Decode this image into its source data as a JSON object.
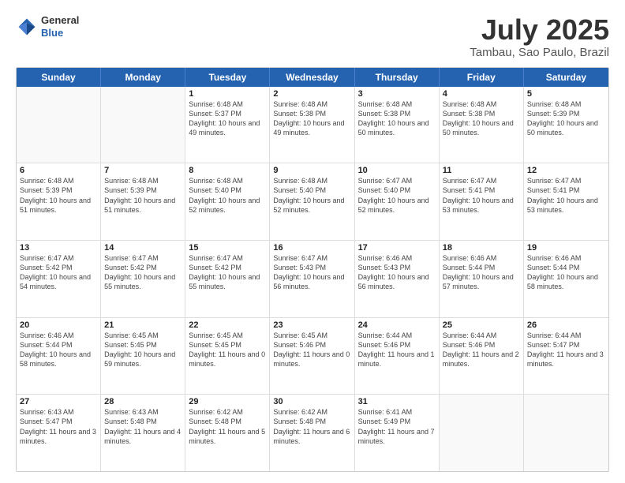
{
  "header": {
    "logo_line1": "General",
    "logo_line2": "Blue",
    "month_year": "July 2025",
    "location": "Tambau, Sao Paulo, Brazil"
  },
  "days_of_week": [
    "Sunday",
    "Monday",
    "Tuesday",
    "Wednesday",
    "Thursday",
    "Friday",
    "Saturday"
  ],
  "weeks": [
    [
      {
        "day": "",
        "info": ""
      },
      {
        "day": "",
        "info": ""
      },
      {
        "day": "1",
        "info": "Sunrise: 6:48 AM\nSunset: 5:37 PM\nDaylight: 10 hours and 49 minutes."
      },
      {
        "day": "2",
        "info": "Sunrise: 6:48 AM\nSunset: 5:38 PM\nDaylight: 10 hours and 49 minutes."
      },
      {
        "day": "3",
        "info": "Sunrise: 6:48 AM\nSunset: 5:38 PM\nDaylight: 10 hours and 50 minutes."
      },
      {
        "day": "4",
        "info": "Sunrise: 6:48 AM\nSunset: 5:38 PM\nDaylight: 10 hours and 50 minutes."
      },
      {
        "day": "5",
        "info": "Sunrise: 6:48 AM\nSunset: 5:39 PM\nDaylight: 10 hours and 50 minutes."
      }
    ],
    [
      {
        "day": "6",
        "info": "Sunrise: 6:48 AM\nSunset: 5:39 PM\nDaylight: 10 hours and 51 minutes."
      },
      {
        "day": "7",
        "info": "Sunrise: 6:48 AM\nSunset: 5:39 PM\nDaylight: 10 hours and 51 minutes."
      },
      {
        "day": "8",
        "info": "Sunrise: 6:48 AM\nSunset: 5:40 PM\nDaylight: 10 hours and 52 minutes."
      },
      {
        "day": "9",
        "info": "Sunrise: 6:48 AM\nSunset: 5:40 PM\nDaylight: 10 hours and 52 minutes."
      },
      {
        "day": "10",
        "info": "Sunrise: 6:47 AM\nSunset: 5:40 PM\nDaylight: 10 hours and 52 minutes."
      },
      {
        "day": "11",
        "info": "Sunrise: 6:47 AM\nSunset: 5:41 PM\nDaylight: 10 hours and 53 minutes."
      },
      {
        "day": "12",
        "info": "Sunrise: 6:47 AM\nSunset: 5:41 PM\nDaylight: 10 hours and 53 minutes."
      }
    ],
    [
      {
        "day": "13",
        "info": "Sunrise: 6:47 AM\nSunset: 5:42 PM\nDaylight: 10 hours and 54 minutes."
      },
      {
        "day": "14",
        "info": "Sunrise: 6:47 AM\nSunset: 5:42 PM\nDaylight: 10 hours and 55 minutes."
      },
      {
        "day": "15",
        "info": "Sunrise: 6:47 AM\nSunset: 5:42 PM\nDaylight: 10 hours and 55 minutes."
      },
      {
        "day": "16",
        "info": "Sunrise: 6:47 AM\nSunset: 5:43 PM\nDaylight: 10 hours and 56 minutes."
      },
      {
        "day": "17",
        "info": "Sunrise: 6:46 AM\nSunset: 5:43 PM\nDaylight: 10 hours and 56 minutes."
      },
      {
        "day": "18",
        "info": "Sunrise: 6:46 AM\nSunset: 5:44 PM\nDaylight: 10 hours and 57 minutes."
      },
      {
        "day": "19",
        "info": "Sunrise: 6:46 AM\nSunset: 5:44 PM\nDaylight: 10 hours and 58 minutes."
      }
    ],
    [
      {
        "day": "20",
        "info": "Sunrise: 6:46 AM\nSunset: 5:44 PM\nDaylight: 10 hours and 58 minutes."
      },
      {
        "day": "21",
        "info": "Sunrise: 6:45 AM\nSunset: 5:45 PM\nDaylight: 10 hours and 59 minutes."
      },
      {
        "day": "22",
        "info": "Sunrise: 6:45 AM\nSunset: 5:45 PM\nDaylight: 11 hours and 0 minutes."
      },
      {
        "day": "23",
        "info": "Sunrise: 6:45 AM\nSunset: 5:46 PM\nDaylight: 11 hours and 0 minutes."
      },
      {
        "day": "24",
        "info": "Sunrise: 6:44 AM\nSunset: 5:46 PM\nDaylight: 11 hours and 1 minute."
      },
      {
        "day": "25",
        "info": "Sunrise: 6:44 AM\nSunset: 5:46 PM\nDaylight: 11 hours and 2 minutes."
      },
      {
        "day": "26",
        "info": "Sunrise: 6:44 AM\nSunset: 5:47 PM\nDaylight: 11 hours and 3 minutes."
      }
    ],
    [
      {
        "day": "27",
        "info": "Sunrise: 6:43 AM\nSunset: 5:47 PM\nDaylight: 11 hours and 3 minutes."
      },
      {
        "day": "28",
        "info": "Sunrise: 6:43 AM\nSunset: 5:48 PM\nDaylight: 11 hours and 4 minutes."
      },
      {
        "day": "29",
        "info": "Sunrise: 6:42 AM\nSunset: 5:48 PM\nDaylight: 11 hours and 5 minutes."
      },
      {
        "day": "30",
        "info": "Sunrise: 6:42 AM\nSunset: 5:48 PM\nDaylight: 11 hours and 6 minutes."
      },
      {
        "day": "31",
        "info": "Sunrise: 6:41 AM\nSunset: 5:49 PM\nDaylight: 11 hours and 7 minutes."
      },
      {
        "day": "",
        "info": ""
      },
      {
        "day": "",
        "info": ""
      }
    ]
  ]
}
